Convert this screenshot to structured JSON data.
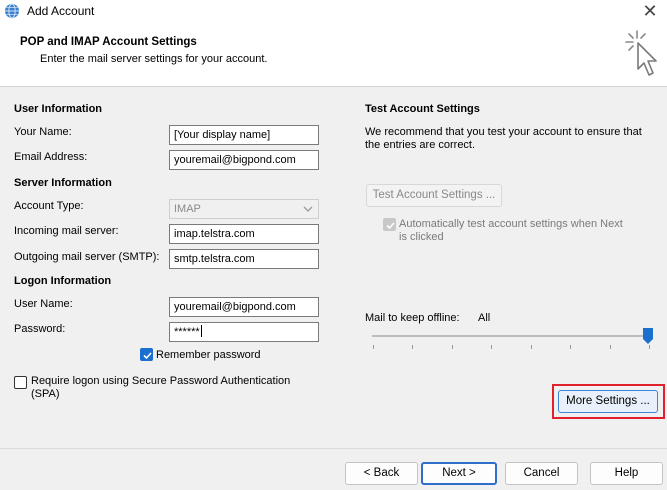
{
  "window": {
    "title": "Add Account",
    "close_label": "✕"
  },
  "header": {
    "title": "POP and IMAP Account Settings",
    "subtitle": "Enter the mail server settings for your account."
  },
  "user_info": {
    "heading": "User Information",
    "your_name_label": "Your Name:",
    "your_name_value": "[Your display name]",
    "email_label": "Email Address:",
    "email_value": "youremail@bigpond.com"
  },
  "server_info": {
    "heading": "Server Information",
    "account_type_label": "Account Type:",
    "account_type_value": "IMAP",
    "incoming_label": "Incoming mail server:",
    "incoming_value": "imap.telstra.com",
    "outgoing_label": "Outgoing mail server (SMTP):",
    "outgoing_value": "smtp.telstra.com"
  },
  "logon_info": {
    "heading": "Logon Information",
    "username_label": "User Name:",
    "username_value": "youremail@bigpond.com",
    "password_label": "Password:",
    "password_value": "******",
    "remember_label": "Remember password",
    "remember_checked": true,
    "spa_label_line1": "Require logon using Secure Password Authentication",
    "spa_label_line2": "(SPA)",
    "spa_checked": false
  },
  "test_settings": {
    "heading": "Test Account Settings",
    "desc_line1": "We recommend that you test your account to ensure that",
    "desc_line2": "the entries are correct.",
    "test_button": "Test Account Settings ...",
    "auto_test_line1": "Automatically test account settings when Next",
    "auto_test_line2": "is clicked",
    "auto_test_checked": true
  },
  "offline": {
    "label": "Mail to keep offline:",
    "value": "All",
    "slider_fraction": 1.0
  },
  "buttons": {
    "more_settings": "More Settings ...",
    "back": "< Back",
    "next": "Next >",
    "cancel": "Cancel",
    "help": "Help"
  },
  "colors": {
    "accent": "#1a6fcf",
    "highlight": "#e0202a"
  },
  "icons": {
    "title": "outlook-globe-icon",
    "header": "click-cursor-icon",
    "dropdown": "chevron-down-icon"
  }
}
